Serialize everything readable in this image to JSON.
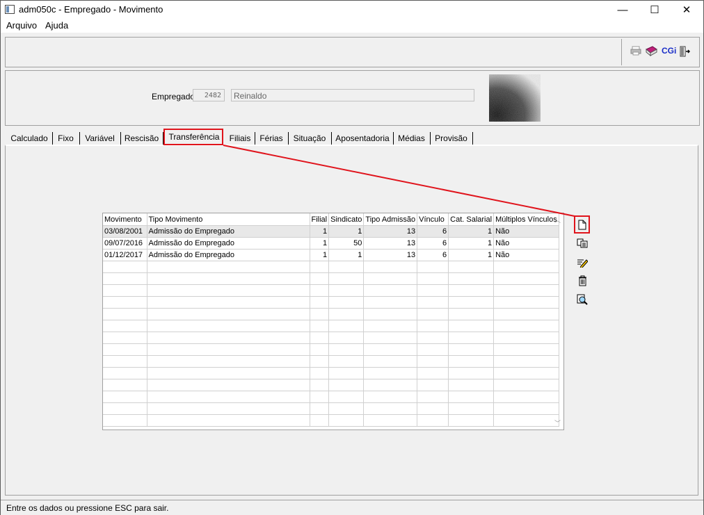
{
  "window": {
    "title": "adm050c - Empregado - Movimento",
    "minimize": "—",
    "maximize": "☐",
    "close": "✕"
  },
  "menu": {
    "items": [
      "Arquivo",
      "Ajuda"
    ]
  },
  "toolbar": {
    "icons": [
      "printer-icon",
      "book-icon",
      "cgi-icon",
      "exit-icon"
    ],
    "cgi_label": "CGi"
  },
  "employee": {
    "label": "Empregado:",
    "code": "2482",
    "name": "Reinaldo"
  },
  "tabs": [
    "Calculado",
    "Fixo",
    "Variável",
    "Rescisão",
    "Transferência",
    "Filiais",
    "Férias",
    "Situação",
    "Aposentadoria",
    "Médias",
    "Provisão"
  ],
  "active_tab": "Transferência",
  "grid": {
    "columns": [
      "Movimento",
      "Tipo Movimento",
      "Filial",
      "Sindicato",
      "Tipo Admissão",
      "Vínculo",
      "Cat. Salarial",
      "Múltiplos Vínculos"
    ],
    "rows": [
      [
        "03/08/2001",
        "Admissão do Empregado",
        "1",
        "1",
        "13",
        "6",
        "1",
        "Não"
      ],
      [
        "09/07/2016",
        "Admissão do Empregado",
        "1",
        "50",
        "13",
        "6",
        "1",
        "Não"
      ],
      [
        "01/12/2017",
        "Admissão do Empregado",
        "1",
        "1",
        "13",
        "6",
        "1",
        "Não"
      ]
    ],
    "selected_row": 0
  },
  "side_actions": [
    "new-record-icon",
    "copy-icon",
    "edit-icon",
    "delete-icon",
    "search-icon"
  ],
  "status": {
    "text": "Entre os dados ou pressione ESC para sair."
  },
  "colors": {
    "highlight": "#e0141c",
    "panel": "#f0f0f0",
    "grid_line": "#d0d0d0"
  }
}
